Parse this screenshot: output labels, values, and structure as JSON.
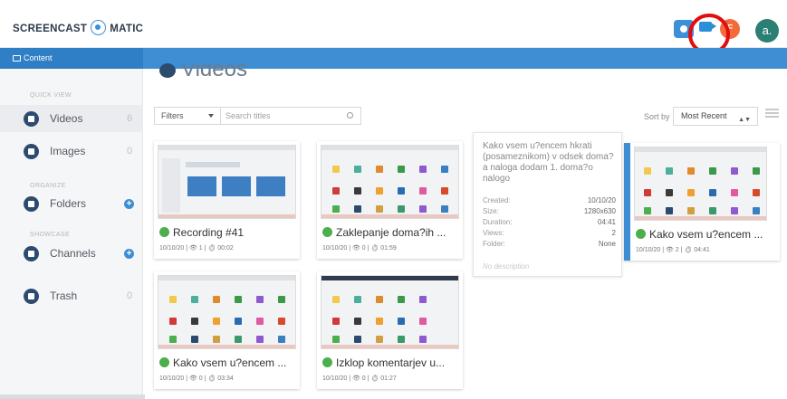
{
  "header": {
    "logo_left": "SCREENCAST",
    "logo_right": "MATIC",
    "badge_letter": "F",
    "avatar_letter": "a.",
    "icons": [
      "camera-icon",
      "record-icon"
    ]
  },
  "nav": {
    "content_label": "Content"
  },
  "sidebar": {
    "quick_view_label": "QUICK VIEW",
    "organize_label": "ORGANIZE",
    "showcase_label": "SHOWCASE",
    "items": [
      {
        "label": "Videos",
        "count": "6"
      },
      {
        "label": "Images",
        "count": "0"
      },
      {
        "label": "Folders",
        "count": "+"
      },
      {
        "label": "Channels",
        "count": "+"
      },
      {
        "label": "Trash",
        "count": "0"
      }
    ]
  },
  "main": {
    "title": "Videos",
    "filters_label": "Filters",
    "search_placeholder": "Search titles",
    "sort_label": "Sort by",
    "sort_value": "Most Recent"
  },
  "cards": [
    {
      "title": "Recording #41",
      "meta": "10/10/20 | 👁 1 | ⏱ 00:02"
    },
    {
      "title": "Zaklepanje doma?ih ...",
      "meta": "10/10/20 | 👁 0 | ⏱ 01:59"
    },
    {
      "title": "Kako vsem u?encem ...",
      "meta": "10/10/20 | 👁 2 | ⏱ 04:41"
    },
    {
      "title": "Kako vsem u?encem ...",
      "meta": "10/10/20 | 👁 0 | ⏱ 03:34"
    },
    {
      "title": "Izklop komentarjev u...",
      "meta": "10/10/20 | 👁 0 | ⏱ 01:27"
    }
  ],
  "detail": {
    "title": "Kako vsem u?encem hkrati (posameznikom) v odsek doma?a naloga dodam 1. doma?o nalogo",
    "rows": [
      {
        "label": "Created:",
        "value": "10/10/20"
      },
      {
        "label": "Size:",
        "value": "1280x630"
      },
      {
        "label": "Duration:",
        "value": "04:41"
      },
      {
        "label": "Views:",
        "value": "2"
      },
      {
        "label": "Folder:",
        "value": "None"
      }
    ],
    "description": "No description"
  }
}
